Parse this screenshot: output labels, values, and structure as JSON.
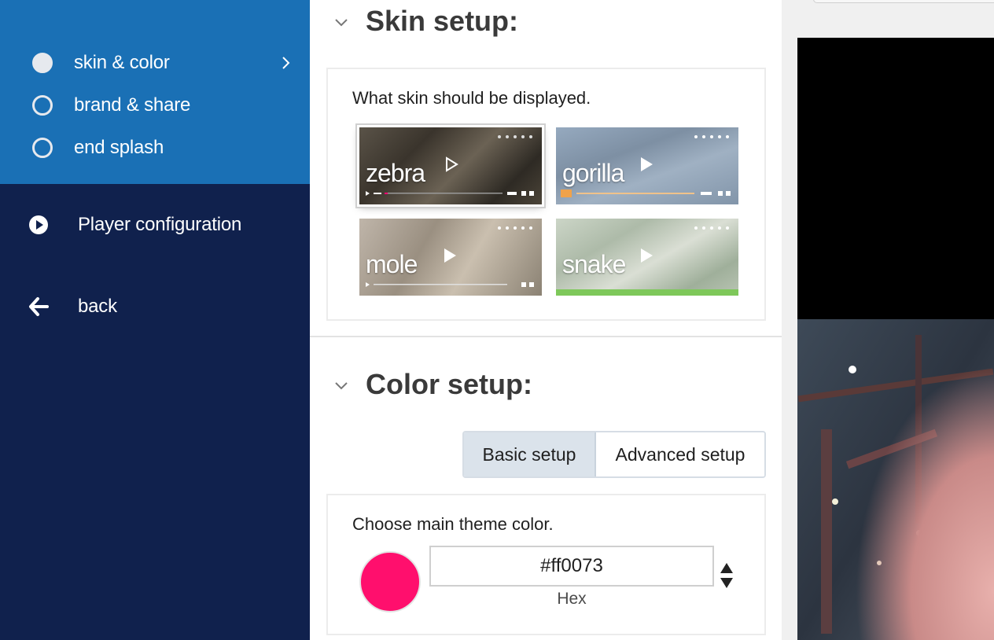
{
  "sidebar": {
    "sub_items": [
      {
        "label": "skin & color",
        "active": true
      },
      {
        "label": "brand & share",
        "active": false
      },
      {
        "label": "end splash",
        "active": false
      }
    ],
    "nav": {
      "player_config": "Player configuration",
      "back": "back"
    },
    "colors": {
      "top": "#1a70b5",
      "bottom": "#10214d"
    }
  },
  "skin_setup": {
    "title": "Skin setup:",
    "prompt": "What skin should be displayed.",
    "skins": [
      {
        "name": "zebra",
        "selected": true
      },
      {
        "name": "gorilla",
        "selected": false
      },
      {
        "name": "mole",
        "selected": false
      },
      {
        "name": "snake",
        "selected": false
      }
    ]
  },
  "color_setup": {
    "title": "Color setup:",
    "tabs": {
      "basic": "Basic setup",
      "advanced": "Advanced setup",
      "active": "basic"
    },
    "prompt": "Choose main theme color.",
    "hex_value": "#ff0073",
    "hex_label": "Hex",
    "swatch_color": "#ff0f6d"
  }
}
